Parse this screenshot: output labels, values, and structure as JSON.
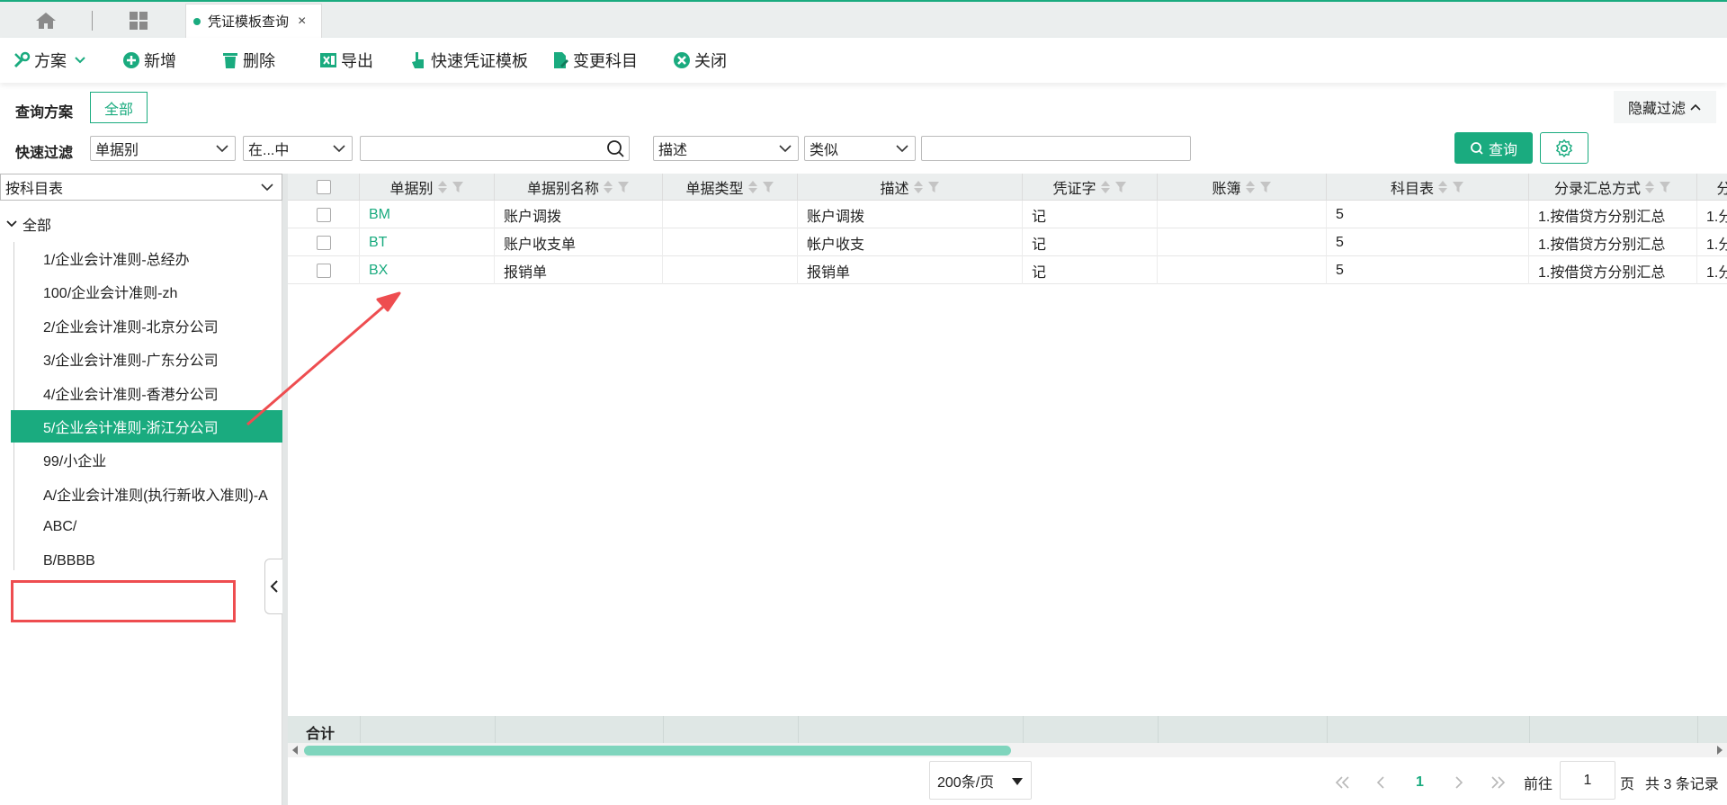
{
  "tabs": {
    "active_tab": "凭证模板查询",
    "close": "×"
  },
  "toolbar": {
    "scheme": "方案",
    "add": "新增",
    "delete": "删除",
    "export": "导出",
    "quick_template": "快速凭证模板",
    "change_subject": "变更科目",
    "close": "关闭"
  },
  "query": {
    "scheme_label": "查询方案",
    "all_button": "全部",
    "hide_filter": "隐藏过滤",
    "quick_filter_label": "快速过滤",
    "field1": "单据别",
    "op1": "在...中",
    "field2": "描述",
    "op2": "类似",
    "query_button": "查询"
  },
  "left_panel": {
    "tree_select": "按科目表",
    "root": "全部",
    "items": [
      "1/企业会计准则-总经办",
      "100/企业会计准则-zh",
      "2/企业会计准则-北京分公司",
      "3/企业会计准则-广东分公司",
      "4/企业会计准则-香港分公司",
      "5/企业会计准则-浙江分公司",
      "99/小企业",
      "A/企业会计准则(执行新收入准则)-A",
      "ABC/",
      "B/BBBB"
    ],
    "selected_index": 5
  },
  "grid": {
    "columns": [
      "单据别",
      "单据别名称",
      "单据类型",
      "描述",
      "凭证字",
      "账簿",
      "科目表",
      "分录汇总方式",
      "分"
    ],
    "rows": [
      [
        "BM",
        "账户调拨",
        "",
        "账户调拨",
        "记",
        "",
        "5",
        "1.按借贷方分别汇总",
        "1.分"
      ],
      [
        "BT",
        "账户收支单",
        "",
        "帐户收支",
        "记",
        "",
        "5",
        "1.按借贷方分别汇总",
        "1.分"
      ],
      [
        "BX",
        "报销单",
        "",
        "报销单",
        "记",
        "",
        "5",
        "1.按借贷方分别汇总",
        "1.分"
      ]
    ],
    "summary_label": "合计"
  },
  "pager": {
    "page_size": "200条/页",
    "current_page": "1",
    "goto_label": "前往",
    "goto_value": "1",
    "page_unit": "页",
    "total": "共 3 条记录"
  },
  "colors": {
    "accent": "#1aab7f",
    "highlight": "#ee4d50"
  }
}
